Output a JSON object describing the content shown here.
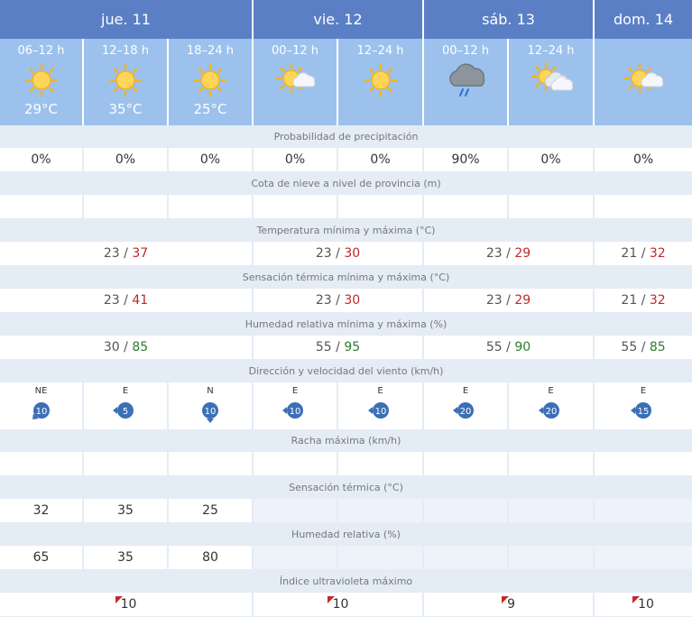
{
  "days": [
    {
      "label": "jue. 11",
      "span": 3
    },
    {
      "label": "vie. 12",
      "span": 2
    },
    {
      "label": "sáb. 13",
      "span": 2
    },
    {
      "label": "dom. 14",
      "span": 1
    }
  ],
  "periods": [
    {
      "label": "06–12 h",
      "icon": "sun-icon",
      "temp": "29°C"
    },
    {
      "label": "12–18 h",
      "icon": "sun-icon",
      "temp": "35°C"
    },
    {
      "label": "18–24 h",
      "icon": "sun-icon",
      "temp": "25°C"
    },
    {
      "label": "00–12 h",
      "icon": "sun-cloud-icon",
      "temp": ""
    },
    {
      "label": "12–24 h",
      "icon": "sun-icon",
      "temp": ""
    },
    {
      "label": "00–12 h",
      "icon": "rain-cloud-icon",
      "temp": ""
    },
    {
      "label": "12–24 h",
      "icon": "sun-clouds-icon",
      "temp": ""
    },
    {
      "label": "",
      "icon": "sun-cloud-icon",
      "temp": ""
    }
  ],
  "rows": {
    "precip_label": "Probabilidad de precipitación",
    "precip": [
      "0%",
      "0%",
      "0%",
      "0%",
      "0%",
      "90%",
      "0%",
      "0%"
    ],
    "snow_label": "Cota de nieve a nivel de provincia (m)",
    "snow": [
      "",
      "",
      "",
      "",
      "",
      "",
      "",
      ""
    ],
    "temp_label": "Temperatura mínima y máxima (°C)",
    "temp": [
      {
        "min": "23",
        "max": "37"
      },
      {
        "min": "23",
        "max": "30"
      },
      {
        "min": "23",
        "max": "29"
      },
      {
        "min": "21",
        "max": "32"
      }
    ],
    "feel_label": "Sensación térmica mínima y máxima (°C)",
    "feel": [
      {
        "min": "23",
        "max": "41"
      },
      {
        "min": "23",
        "max": "30"
      },
      {
        "min": "23",
        "max": "29"
      },
      {
        "min": "21",
        "max": "32"
      }
    ],
    "hum_label": "Humedad relativa mínima y máxima (%)",
    "hum": [
      {
        "min": "30",
        "max": "85"
      },
      {
        "min": "55",
        "max": "95"
      },
      {
        "min": "55",
        "max": "90"
      },
      {
        "min": "55",
        "max": "85"
      }
    ],
    "separator": "/",
    "wind_label": "Dirección y velocidad del viento (km/h)",
    "wind": [
      {
        "dir": "NE",
        "speed": "10"
      },
      {
        "dir": "E",
        "speed": "5"
      },
      {
        "dir": "N",
        "speed": "10"
      },
      {
        "dir": "E",
        "speed": "10"
      },
      {
        "dir": "E",
        "speed": "10"
      },
      {
        "dir": "E",
        "speed": "20"
      },
      {
        "dir": "E",
        "speed": "20"
      },
      {
        "dir": "E",
        "speed": "15"
      }
    ],
    "gust_label": "Racha máxima (km/h)",
    "gust": [
      "",
      "",
      "",
      "",
      "",
      "",
      "",
      ""
    ],
    "st_label": "Sensación térmica (°C)",
    "st": [
      "32",
      "35",
      "25"
    ],
    "hr_label": "Humedad relativa (%)",
    "hr": [
      "65",
      "35",
      "80"
    ],
    "uv_label": "Índice ultravioleta máximo",
    "uv": [
      "10",
      "10",
      "9",
      "10"
    ]
  },
  "colors": {
    "day_header": "#5b7fc5",
    "period_header": "#9cc1ec",
    "row_label_bg": "#e4ecf5",
    "max_temp": "#c0282a",
    "max_humidity": "#2e7d32",
    "wind_badge": "#3b6fb6",
    "uv_flag": "#c62828"
  }
}
